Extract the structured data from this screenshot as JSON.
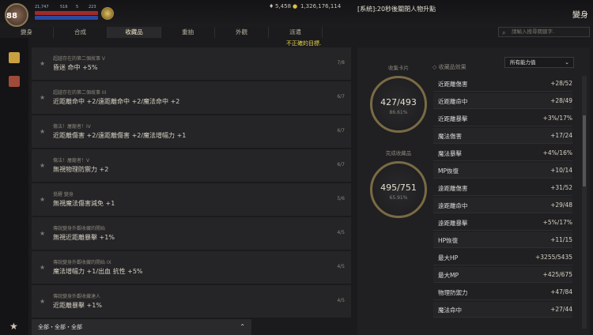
{
  "header": {
    "level": "88",
    "stat_a": "21,747",
    "stat_b": "516",
    "stat_c": "5",
    "stat_d": "223",
    "hp_text": "5,700/6,475",
    "mp_text": "5,400/5,435",
    "currency_a": "5,458",
    "currency_b": "1,326,176,114",
    "system_message": "[系統]:20秒後關閉人物升點",
    "title": "變身"
  },
  "tabs": [
    {
      "label": "變身"
    },
    {
      "label": "合成"
    },
    {
      "label": "收藏品"
    },
    {
      "label": "重抽"
    },
    {
      "label": "外觀"
    },
    {
      "label": "派遣"
    }
  ],
  "warning": "不正確的目標.",
  "search": {
    "placeholder": "請輸入搜尋關鍵字."
  },
  "collections": [
    {
      "subtitle": "超越存在的第二個故事 V",
      "effect": "昏迷 命中 +5%",
      "count": "7/8"
    },
    {
      "subtitle": "超越存在的第二個故事 III",
      "effect": "近距離命中 +2/遠距離命中 +2/魔法命中 +2",
      "count": "6/7"
    },
    {
      "subtitle": "傷法！屠龍者！IV",
      "effect": "近距離傷害 +2/遠距離傷害 +2/魔法增幅力 +1",
      "count": "6/7"
    },
    {
      "subtitle": "傷法！屠龍者！V",
      "effect": "無視物理防禦力 +2",
      "count": "6/7"
    },
    {
      "subtitle": "覺醒  變身",
      "effect": "無視魔法傷害減免 +1",
      "count": "5/6"
    },
    {
      "subtitle": "傳說變身外觀收藏的開始",
      "effect": "無視近距離暴擊 +1%",
      "count": "4/5"
    },
    {
      "subtitle": "傳說變身外觀收藏的開始 IX",
      "effect": "魔法增幅力 +1/出血 抗性 +5%",
      "count": "4/5"
    },
    {
      "subtitle": "傳說變身外觀收藏達人",
      "effect": "近距離暴擊 +1%",
      "count": "4/5"
    }
  ],
  "filter": {
    "label": "全部・全部・全部"
  },
  "summary": {
    "card_label": "收集卡片",
    "card_value": "427/493",
    "card_pct": "86.61%",
    "done_label": "完成收藏品",
    "done_value": "495/751",
    "done_pct": "65.91%",
    "effects_header": "◇ 收藏品效果",
    "dropdown_value": "所有能力值"
  },
  "effects": [
    {
      "name": "近距離傷害",
      "value": "+28/52"
    },
    {
      "name": "近距離命中",
      "value": "+28/49"
    },
    {
      "name": "近距離暴擊",
      "value": "+3%/17%"
    },
    {
      "name": "魔法傷害",
      "value": "+17/24"
    },
    {
      "name": "魔法暴擊",
      "value": "+4%/16%"
    },
    {
      "name": "MP恢復",
      "value": "+10/14"
    },
    {
      "name": "遠距離傷害",
      "value": "+31/52"
    },
    {
      "name": "遠距離命中",
      "value": "+29/48"
    },
    {
      "name": "遠距離暴擊",
      "value": "+5%/17%"
    },
    {
      "name": "HP恢復",
      "value": "+11/15"
    },
    {
      "name": "最大HP",
      "value": "+3255/5435"
    },
    {
      "name": "最大MP",
      "value": "+425/675"
    },
    {
      "name": "物理防禦力",
      "value": "+47/84"
    },
    {
      "name": "魔法命中",
      "value": "+27/44"
    }
  ]
}
